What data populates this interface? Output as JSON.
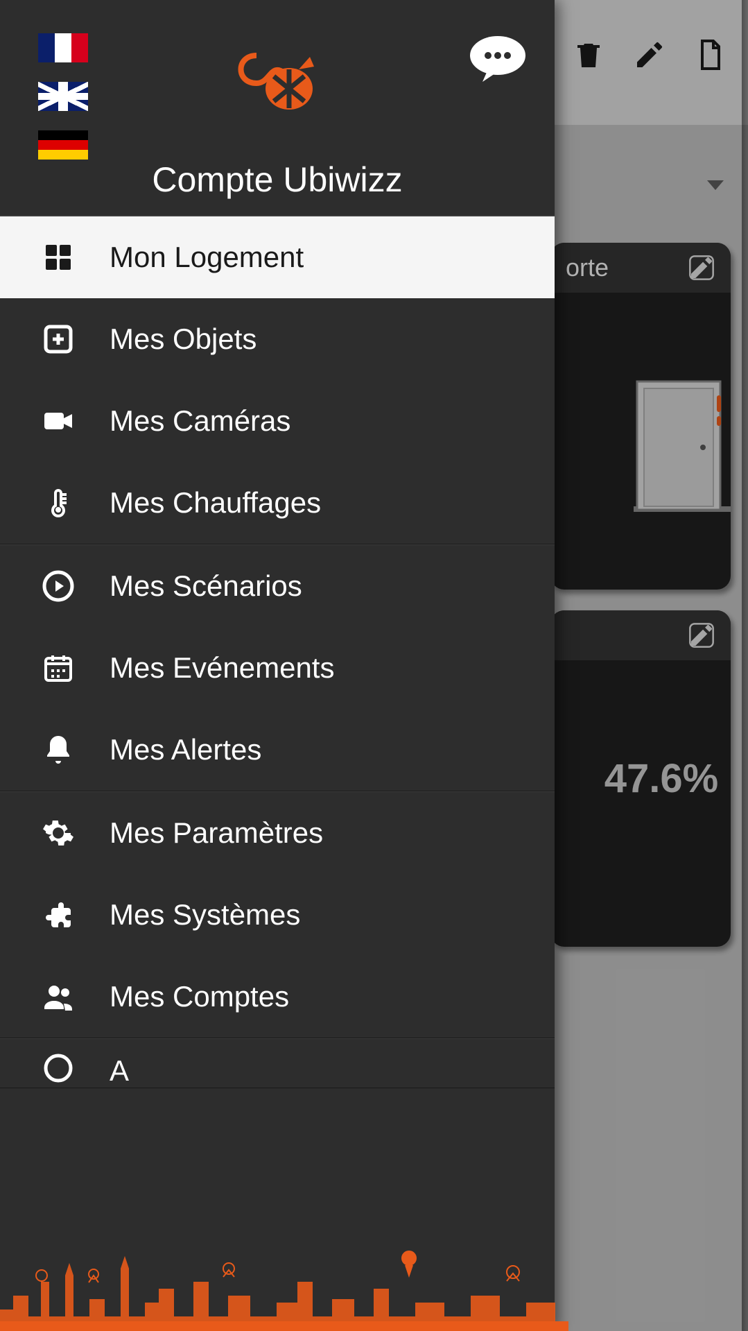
{
  "drawer": {
    "title": "Compte Ubiwizz",
    "menu": {
      "group1": [
        {
          "label": "Mon Logement"
        },
        {
          "label": "Mes Objets"
        },
        {
          "label": "Mes Caméras"
        },
        {
          "label": "Mes Chauffages"
        }
      ],
      "group2": [
        {
          "label": "Mes Scénarios"
        },
        {
          "label": "Mes Evénements"
        },
        {
          "label": "Mes Alertes"
        }
      ],
      "group3": [
        {
          "label": "Mes Paramètres"
        },
        {
          "label": "Mes Systèmes"
        },
        {
          "label": "Mes Comptes"
        }
      ],
      "partial_label_fragment": "A"
    }
  },
  "bg": {
    "card1_title_fragment": "orte",
    "card2_value": "47.6%"
  },
  "colors": {
    "accent": "#e85a1a"
  }
}
